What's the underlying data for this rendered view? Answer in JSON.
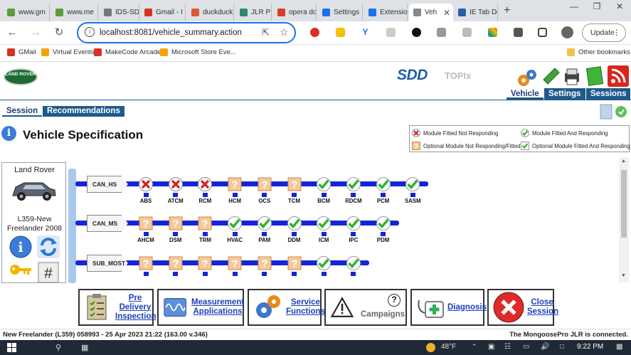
{
  "browser": {
    "tabs": [
      {
        "label": "www.gm",
        "color": "#5a9e3c"
      },
      {
        "label": "www.me",
        "color": "#5a9e3c"
      },
      {
        "label": "IDS-SDD",
        "color": "#777777"
      },
      {
        "label": "Gmail - I",
        "color": "#d93025"
      },
      {
        "label": "duckduck",
        "color": "#de5833"
      },
      {
        "label": "JLR Pro J",
        "color": "#2a8a6a"
      },
      {
        "label": "opera do",
        "color": "#d4402c"
      },
      {
        "label": "Settings",
        "color": "#1a73e8"
      },
      {
        "label": "Extension",
        "color": "#1a73e8"
      },
      {
        "label": "Veh",
        "color": "#888888"
      },
      {
        "label": "IE Tab Do",
        "color": "#2a5ea8"
      }
    ],
    "url": "localhost:8081/vehicle_summary.action",
    "update_label": "Update",
    "bookmarks": [
      {
        "label": "GMail",
        "color": "#d93025"
      },
      {
        "label": "Virtual Events",
        "color": "#f4a400"
      },
      {
        "label": "MakeCode Arcade",
        "color": "#d93025"
      },
      {
        "label": "Microsoft Store Eve...",
        "color": "#f4a400"
      }
    ],
    "other_bookmarks": "Other bookmarks"
  },
  "app": {
    "logo_text": "LAND ROVER",
    "brand": "SDD",
    "sub_brand": "TOPIx",
    "menu": {
      "vehicle": "Vehicle",
      "settings": "Settings",
      "sessions": "Sessions"
    },
    "subtabs": {
      "session": "Session",
      "recommendations": "Recommendations"
    },
    "title": "Vehicle Specification",
    "legend": {
      "fitted_not_responding": "Module Fitted Not Responding",
      "fitted_responding": "Module Fitted And Responding",
      "optional_not_responding": "Optional Module Not Responding/Fitted",
      "optional_responding": "Optional Module Fitted And Responding"
    },
    "vehicle": {
      "make": "Land Rover",
      "model_line1": "L359-New",
      "model_line2": "Freelander 2008"
    },
    "networks": [
      {
        "name": "CAN_HS",
        "modules": [
          {
            "code": "ABS",
            "status": "not_responding"
          },
          {
            "code": "ATCM",
            "status": "not_responding"
          },
          {
            "code": "RCM",
            "status": "not_responding"
          },
          {
            "code": "HCM",
            "status": "optional"
          },
          {
            "code": "OCS",
            "status": "optional"
          },
          {
            "code": "TCM",
            "status": "optional"
          },
          {
            "code": "BCM",
            "status": "responding"
          },
          {
            "code": "RDCM",
            "status": "responding"
          },
          {
            "code": "PCM",
            "status": "responding"
          },
          {
            "code": "SASM",
            "status": "responding"
          }
        ]
      },
      {
        "name": "CAN_MS",
        "modules": [
          {
            "code": "AHCM",
            "status": "optional"
          },
          {
            "code": "DSM",
            "status": "optional"
          },
          {
            "code": "TRM",
            "status": "optional"
          },
          {
            "code": "HVAC",
            "status": "responding"
          },
          {
            "code": "PAM",
            "status": "responding"
          },
          {
            "code": "DDM",
            "status": "responding"
          },
          {
            "code": "ICM",
            "status": "responding"
          },
          {
            "code": "IPC",
            "status": "responding"
          },
          {
            "code": "PDM",
            "status": "responding"
          }
        ]
      },
      {
        "name": "SUB_MOST",
        "modules": [
          {
            "code": "",
            "status": "optional"
          },
          {
            "code": "",
            "status": "optional"
          },
          {
            "code": "",
            "status": "optional"
          },
          {
            "code": "",
            "status": "optional"
          },
          {
            "code": "",
            "status": "optional"
          },
          {
            "code": "",
            "status": "optional"
          },
          {
            "code": "",
            "status": "responding"
          },
          {
            "code": "",
            "status": "responding"
          }
        ]
      }
    ],
    "buttons": {
      "predelivery": "Pre Delivery Inspection",
      "measurement": "Measurement Applications",
      "service": "Service Functions",
      "campaigns": "Campaigns",
      "diagnosis": "Diagnosis",
      "close": "Close Session"
    },
    "status_left": "New Freelander (L359) 058993 - 25 Apr 2023 21:22 (163.00 v.346)",
    "status_right": "The MongoosePro JLR is connected."
  },
  "taskbar": {
    "weather": "48°F",
    "time": "9:22 PM"
  }
}
